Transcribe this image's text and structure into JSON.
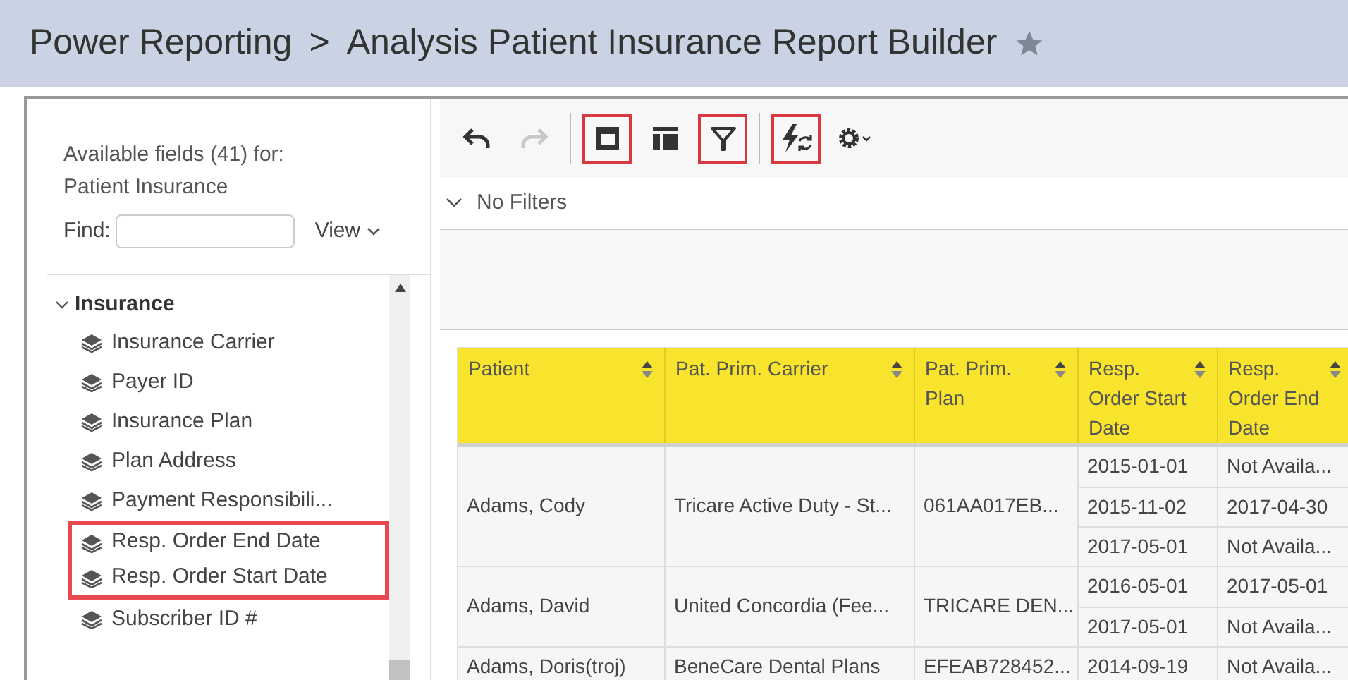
{
  "header": {
    "breadcrumb": [
      "Power Reporting",
      "Analysis Patient Insurance Report Builder"
    ],
    "separator": ">",
    "favorite": false
  },
  "fields_panel": {
    "title": "Available fields (41) for:",
    "subtitle": "Patient Insurance",
    "find_label": "Find:",
    "view_label": "View",
    "groups": [
      {
        "label": "Insurance",
        "expanded": true,
        "children": [
          {
            "label": "Insurance Carrier",
            "highlighted": false
          },
          {
            "label": "Payer ID",
            "highlighted": false
          },
          {
            "label": "Insurance Plan",
            "highlighted": false
          },
          {
            "label": "Plan Address",
            "highlighted": false
          },
          {
            "label": "Payment Responsibili...",
            "highlighted": false
          },
          {
            "label": "Resp. Order End Date",
            "highlighted": true
          },
          {
            "label": "Resp. Order Start Date",
            "highlighted": true
          },
          {
            "label": "Subscriber ID #",
            "highlighted": false
          }
        ]
      }
    ]
  },
  "toolbar": [
    {
      "kind": "undo",
      "disabled": false,
      "highlighted": false
    },
    {
      "kind": "redo",
      "disabled": true,
      "highlighted": false
    },
    {
      "kind": "separator"
    },
    {
      "kind": "layout",
      "disabled": false,
      "highlighted": true
    },
    {
      "kind": "table",
      "disabled": false,
      "highlighted": false
    },
    {
      "kind": "filter",
      "disabled": false,
      "highlighted": true
    },
    {
      "kind": "separator"
    },
    {
      "kind": "refresh",
      "disabled": false,
      "highlighted": true
    },
    {
      "kind": "settings",
      "disabled": false,
      "highlighted": false
    }
  ],
  "filters": {
    "label": "No Filters",
    "expanded": false
  },
  "table": {
    "columns": [
      "Patient",
      "Pat. Prim. Carrier",
      "Pat. Prim. Plan",
      "Resp. Order Start Date",
      "Resp. Order End Date"
    ],
    "rows": [
      {
        "patient": "Adams, Cody",
        "carrier": "Tricare Active Duty - St...",
        "plan": "061AA017EB...",
        "orders": [
          {
            "start": "2015-01-01",
            "end": "Not Availa..."
          },
          {
            "start": "2015-11-02",
            "end": "2017-04-30"
          },
          {
            "start": "2017-05-01",
            "end": "Not Availa..."
          }
        ]
      },
      {
        "patient": "Adams, David",
        "carrier": "United Concordia (Fee...",
        "plan": "TRICARE DEN...",
        "orders": [
          {
            "start": "2016-05-01",
            "end": "2017-05-01"
          },
          {
            "start": "2017-05-01",
            "end": "Not Availa..."
          }
        ]
      },
      {
        "patient": "Adams, Doris(troj)",
        "carrier": "BeneCare Dental Plans",
        "plan": "EFEAB728452...",
        "orders": [
          {
            "start": "2014-09-19",
            "end": "Not Availa..."
          }
        ]
      }
    ]
  }
}
